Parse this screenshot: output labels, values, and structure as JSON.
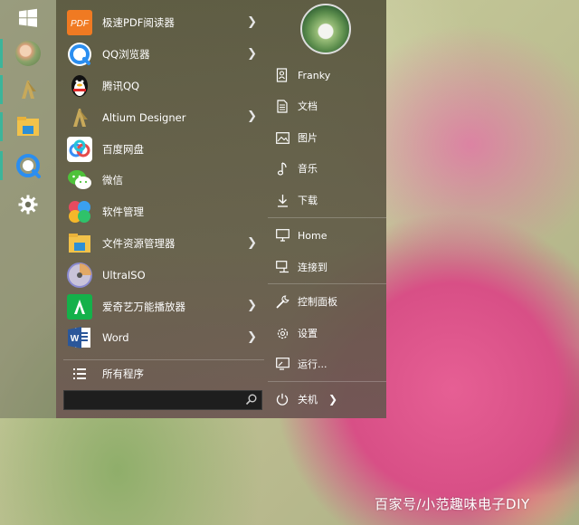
{
  "taskbar": {
    "items": [
      {
        "name": "windows-logo-icon"
      },
      {
        "name": "user-avatar-icon"
      },
      {
        "name": "altium-designer-icon"
      },
      {
        "name": "file-explorer-icon"
      },
      {
        "name": "qq-browser-icon"
      },
      {
        "name": "settings-gear-icon"
      }
    ],
    "accent": "#3cb59a"
  },
  "apps": [
    {
      "label": "极速PDF阅读器",
      "icon": "pdf-reader-icon",
      "color": "#f07a22",
      "submenu": true
    },
    {
      "label": "QQ浏览器",
      "icon": "qq-browser-icon",
      "color": "#2b8ef0",
      "submenu": true
    },
    {
      "label": "腾讯QQ",
      "icon": "qq-penguin-icon",
      "color": "#222222",
      "submenu": false
    },
    {
      "label": "Altium Designer",
      "icon": "altium-designer-icon",
      "color": "#b89a4a",
      "submenu": true
    },
    {
      "label": "百度网盘",
      "icon": "baidu-netdisk-icon",
      "color": "#3a8ef5",
      "submenu": false
    },
    {
      "label": "微信",
      "icon": "wechat-icon",
      "color": "#4ec23a",
      "submenu": false
    },
    {
      "label": "软件管理",
      "icon": "software-manager-icon",
      "color": "#e84a5f",
      "submenu": false
    },
    {
      "label": "文件资源管理器",
      "icon": "file-explorer-icon",
      "color": "#f2c24a",
      "submenu": true
    },
    {
      "label": "UltraISO",
      "icon": "ultraiso-disc-icon",
      "color": "#8a8ad0",
      "submenu": false
    },
    {
      "label": "爱奇艺万能播放器",
      "icon": "iqiyi-player-icon",
      "color": "#14b14a",
      "submenu": true
    },
    {
      "label": "Word",
      "icon": "word-icon",
      "color": "#2b579a",
      "submenu": true
    }
  ],
  "all_programs_label": "所有程序",
  "search": {
    "value": "",
    "placeholder": ""
  },
  "right_panel": {
    "user_name": "Franky",
    "items": [
      {
        "label": "文档",
        "icon": "document-icon"
      },
      {
        "label": "图片",
        "icon": "picture-icon"
      },
      {
        "label": "音乐",
        "icon": "music-note-icon"
      },
      {
        "label": "下载",
        "icon": "download-icon"
      },
      {
        "label": "Home",
        "icon": "computer-icon"
      },
      {
        "label": "连接到",
        "icon": "connect-to-icon"
      },
      {
        "label": "控制面板",
        "icon": "wrench-icon"
      },
      {
        "label": "设置",
        "icon": "gear-icon"
      },
      {
        "label": "运行...",
        "icon": "run-icon"
      }
    ],
    "power_label": "关机"
  },
  "watermark": "百家号/小范趣味电子DIY"
}
